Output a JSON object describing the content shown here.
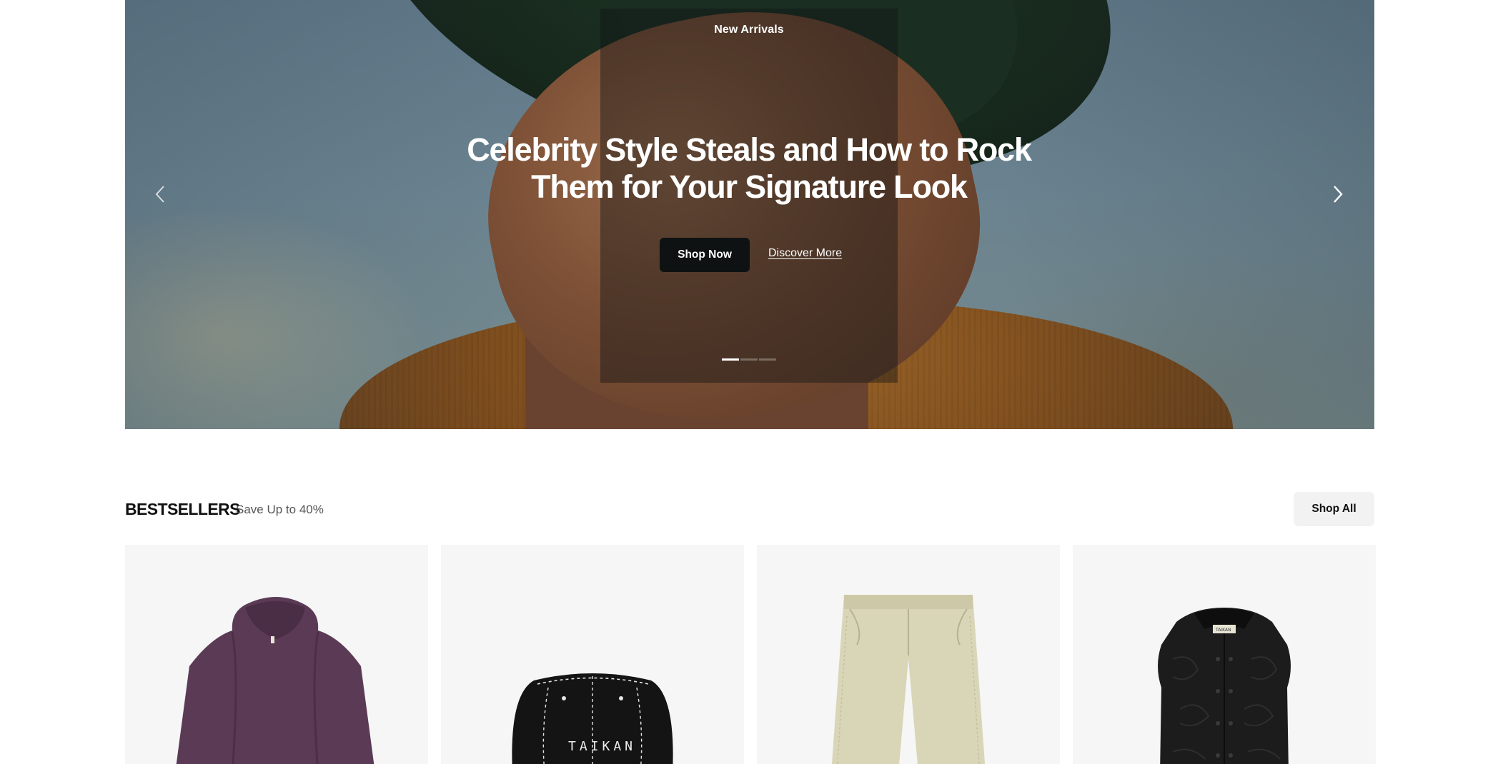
{
  "hero": {
    "eyebrow": "New Arrivals",
    "title": "Celebrity Style Steals and How to Rock Them for Your Signature Look",
    "primary_cta": "Shop Now",
    "secondary_cta": "Discover More",
    "slides_total": 3,
    "active_slide": 1,
    "prev_icon": "chevron-left-icon",
    "next_icon": "chevron-right-icon"
  },
  "bestsellers": {
    "title": "BESTSELLERS",
    "subtitle": "Save Up to 40%",
    "shop_all": "Shop All",
    "products": [
      {
        "kind": "hoodie",
        "color": "#5b3a55"
      },
      {
        "kind": "bucket-hat",
        "color": "#141414",
        "print": "TAIKAN"
      },
      {
        "kind": "pants",
        "color": "#d9d6b8"
      },
      {
        "kind": "vest",
        "color": "#1c1c1c",
        "label": "TAIKAN"
      }
    ]
  },
  "colors": {
    "primary_button": "#0f1212",
    "card_bg": "#f6f6f6",
    "shop_all_bg": "#f2f2f2"
  }
}
